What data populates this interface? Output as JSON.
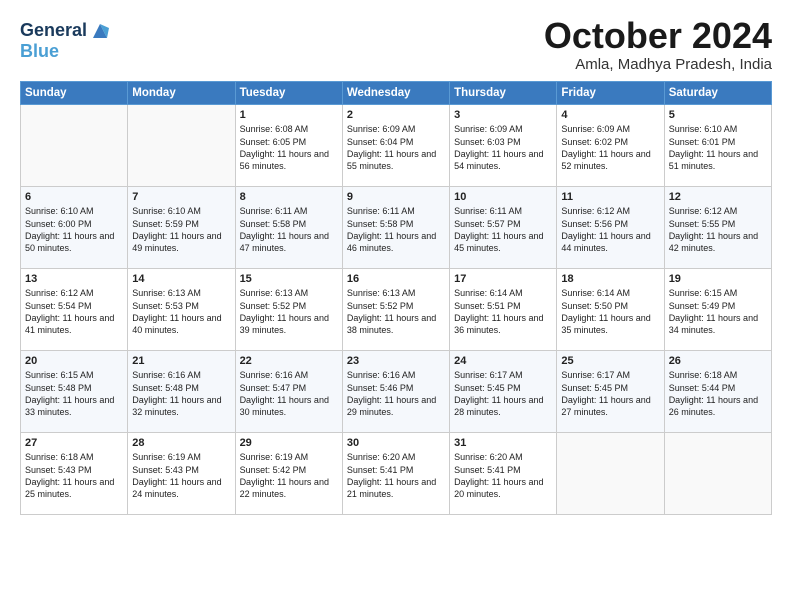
{
  "header": {
    "logo_line1": "General",
    "logo_line2": "Blue",
    "month": "October 2024",
    "location": "Amla, Madhya Pradesh, India"
  },
  "weekdays": [
    "Sunday",
    "Monday",
    "Tuesday",
    "Wednesday",
    "Thursday",
    "Friday",
    "Saturday"
  ],
  "weeks": [
    [
      {
        "day": "",
        "info": ""
      },
      {
        "day": "",
        "info": ""
      },
      {
        "day": "1",
        "info": "Sunrise: 6:08 AM\nSunset: 6:05 PM\nDaylight: 11 hours and 56 minutes."
      },
      {
        "day": "2",
        "info": "Sunrise: 6:09 AM\nSunset: 6:04 PM\nDaylight: 11 hours and 55 minutes."
      },
      {
        "day": "3",
        "info": "Sunrise: 6:09 AM\nSunset: 6:03 PM\nDaylight: 11 hours and 54 minutes."
      },
      {
        "day": "4",
        "info": "Sunrise: 6:09 AM\nSunset: 6:02 PM\nDaylight: 11 hours and 52 minutes."
      },
      {
        "day": "5",
        "info": "Sunrise: 6:10 AM\nSunset: 6:01 PM\nDaylight: 11 hours and 51 minutes."
      }
    ],
    [
      {
        "day": "6",
        "info": "Sunrise: 6:10 AM\nSunset: 6:00 PM\nDaylight: 11 hours and 50 minutes."
      },
      {
        "day": "7",
        "info": "Sunrise: 6:10 AM\nSunset: 5:59 PM\nDaylight: 11 hours and 49 minutes."
      },
      {
        "day": "8",
        "info": "Sunrise: 6:11 AM\nSunset: 5:58 PM\nDaylight: 11 hours and 47 minutes."
      },
      {
        "day": "9",
        "info": "Sunrise: 6:11 AM\nSunset: 5:58 PM\nDaylight: 11 hours and 46 minutes."
      },
      {
        "day": "10",
        "info": "Sunrise: 6:11 AM\nSunset: 5:57 PM\nDaylight: 11 hours and 45 minutes."
      },
      {
        "day": "11",
        "info": "Sunrise: 6:12 AM\nSunset: 5:56 PM\nDaylight: 11 hours and 44 minutes."
      },
      {
        "day": "12",
        "info": "Sunrise: 6:12 AM\nSunset: 5:55 PM\nDaylight: 11 hours and 42 minutes."
      }
    ],
    [
      {
        "day": "13",
        "info": "Sunrise: 6:12 AM\nSunset: 5:54 PM\nDaylight: 11 hours and 41 minutes."
      },
      {
        "day": "14",
        "info": "Sunrise: 6:13 AM\nSunset: 5:53 PM\nDaylight: 11 hours and 40 minutes."
      },
      {
        "day": "15",
        "info": "Sunrise: 6:13 AM\nSunset: 5:52 PM\nDaylight: 11 hours and 39 minutes."
      },
      {
        "day": "16",
        "info": "Sunrise: 6:13 AM\nSunset: 5:52 PM\nDaylight: 11 hours and 38 minutes."
      },
      {
        "day": "17",
        "info": "Sunrise: 6:14 AM\nSunset: 5:51 PM\nDaylight: 11 hours and 36 minutes."
      },
      {
        "day": "18",
        "info": "Sunrise: 6:14 AM\nSunset: 5:50 PM\nDaylight: 11 hours and 35 minutes."
      },
      {
        "day": "19",
        "info": "Sunrise: 6:15 AM\nSunset: 5:49 PM\nDaylight: 11 hours and 34 minutes."
      }
    ],
    [
      {
        "day": "20",
        "info": "Sunrise: 6:15 AM\nSunset: 5:48 PM\nDaylight: 11 hours and 33 minutes."
      },
      {
        "day": "21",
        "info": "Sunrise: 6:16 AM\nSunset: 5:48 PM\nDaylight: 11 hours and 32 minutes."
      },
      {
        "day": "22",
        "info": "Sunrise: 6:16 AM\nSunset: 5:47 PM\nDaylight: 11 hours and 30 minutes."
      },
      {
        "day": "23",
        "info": "Sunrise: 6:16 AM\nSunset: 5:46 PM\nDaylight: 11 hours and 29 minutes."
      },
      {
        "day": "24",
        "info": "Sunrise: 6:17 AM\nSunset: 5:45 PM\nDaylight: 11 hours and 28 minutes."
      },
      {
        "day": "25",
        "info": "Sunrise: 6:17 AM\nSunset: 5:45 PM\nDaylight: 11 hours and 27 minutes."
      },
      {
        "day": "26",
        "info": "Sunrise: 6:18 AM\nSunset: 5:44 PM\nDaylight: 11 hours and 26 minutes."
      }
    ],
    [
      {
        "day": "27",
        "info": "Sunrise: 6:18 AM\nSunset: 5:43 PM\nDaylight: 11 hours and 25 minutes."
      },
      {
        "day": "28",
        "info": "Sunrise: 6:19 AM\nSunset: 5:43 PM\nDaylight: 11 hours and 24 minutes."
      },
      {
        "day": "29",
        "info": "Sunrise: 6:19 AM\nSunset: 5:42 PM\nDaylight: 11 hours and 22 minutes."
      },
      {
        "day": "30",
        "info": "Sunrise: 6:20 AM\nSunset: 5:41 PM\nDaylight: 11 hours and 21 minutes."
      },
      {
        "day": "31",
        "info": "Sunrise: 6:20 AM\nSunset: 5:41 PM\nDaylight: 11 hours and 20 minutes."
      },
      {
        "day": "",
        "info": ""
      },
      {
        "day": "",
        "info": ""
      }
    ]
  ]
}
